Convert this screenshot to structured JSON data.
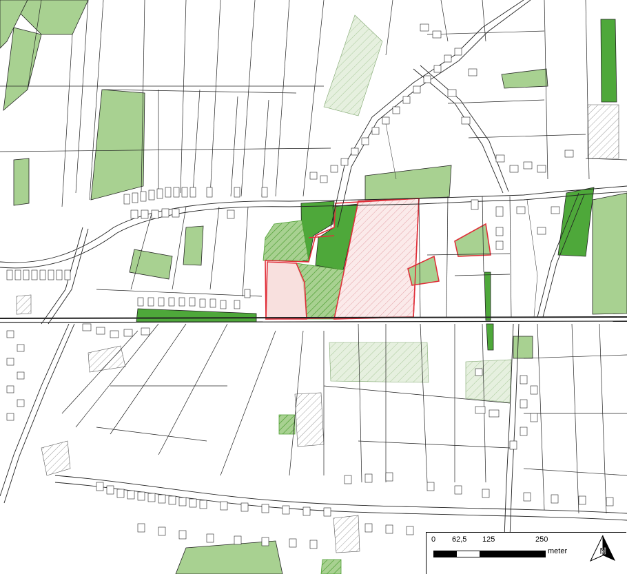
{
  "map": {
    "colors": {
      "background": "#ffffff",
      "parcel_line": "#222222",
      "light_green": "#a8d191",
      "dark_green": "#4ea83a",
      "hatch_grey": "#9a9a9a",
      "hatch_green": "#4e9f33",
      "project_red": "#e0303a",
      "project_fill": "#f3c6c8"
    }
  },
  "scale_bar": {
    "ticks": [
      "0",
      "62,5",
      "125",
      "250"
    ],
    "unit": "meter"
  },
  "north_arrow": {
    "label": "N",
    "icon": "north-arrow-icon"
  }
}
